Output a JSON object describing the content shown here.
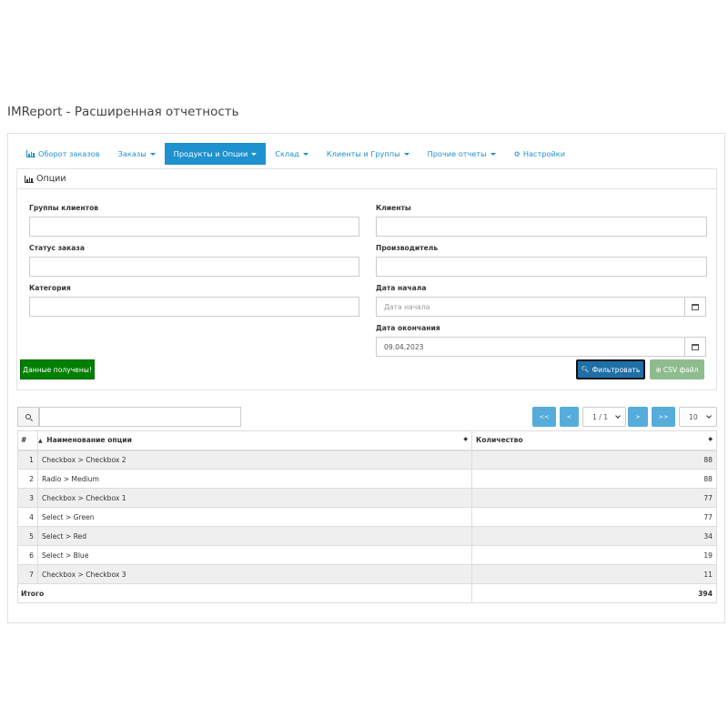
{
  "page": {
    "title": "IMReport - Расширенная отчетность"
  },
  "nav": {
    "items": [
      {
        "label": "Оборот заказов",
        "icon": "bar-chart-icon",
        "dropdown": false,
        "active": false
      },
      {
        "label": "Заказы",
        "dropdown": true,
        "active": false
      },
      {
        "label": "Продукты и Опции",
        "dropdown": true,
        "active": true
      },
      {
        "label": "Склад",
        "dropdown": true,
        "active": false
      },
      {
        "label": "Клиенты и Группы",
        "dropdown": true,
        "active": false
      },
      {
        "label": "Прочие отчеты",
        "dropdown": true,
        "active": false
      },
      {
        "label": "Настройки",
        "icon": "cogs-icon",
        "dropdown": false,
        "active": false
      }
    ]
  },
  "panel": {
    "title": "Опции",
    "fields": {
      "customer_groups": {
        "label": "Группы клиентов",
        "value": ""
      },
      "customers": {
        "label": "Клиенты",
        "value": ""
      },
      "order_status": {
        "label": "Статус заказа",
        "value": ""
      },
      "manufacturer": {
        "label": "Производитель",
        "value": ""
      },
      "category": {
        "label": "Категория",
        "value": ""
      },
      "date_start": {
        "label": "Дата начала",
        "placeholder": "Дата начала",
        "value": ""
      },
      "date_end": {
        "label": "Дата окончания",
        "value": "09.04.2023"
      }
    },
    "status_button": "Данные получены!",
    "filter_button": "Фильтровать",
    "csv_button": "CSV файл"
  },
  "toolbar": {
    "search_value": "",
    "pagination": {
      "first": "<<",
      "prev": "<",
      "page": "1 / 1",
      "next": ">",
      "last": ">>"
    },
    "page_size": "10"
  },
  "table": {
    "columns": {
      "index": "#",
      "name": "Наименование опции",
      "qty": "Количество"
    },
    "rows": [
      {
        "index": "1",
        "name": "Checkbox > Checkbox 2",
        "qty": "88"
      },
      {
        "index": "2",
        "name": "Radio > Medium",
        "qty": "88"
      },
      {
        "index": "3",
        "name": "Checkbox > Checkbox 1",
        "qty": "77"
      },
      {
        "index": "4",
        "name": "Select > Green",
        "qty": "77"
      },
      {
        "index": "5",
        "name": "Select > Red",
        "qty": "34"
      },
      {
        "index": "6",
        "name": "Select > Blue",
        "qty": "19"
      },
      {
        "index": "7",
        "name": "Checkbox > Checkbox 3",
        "qty": "11"
      }
    ],
    "total": {
      "label": "Итого",
      "qty": "394"
    }
  },
  "colors": {
    "accent": "#1e91cf",
    "success": "#008000",
    "filter": "#1e6fa6",
    "csv": "#8fbc8f"
  }
}
